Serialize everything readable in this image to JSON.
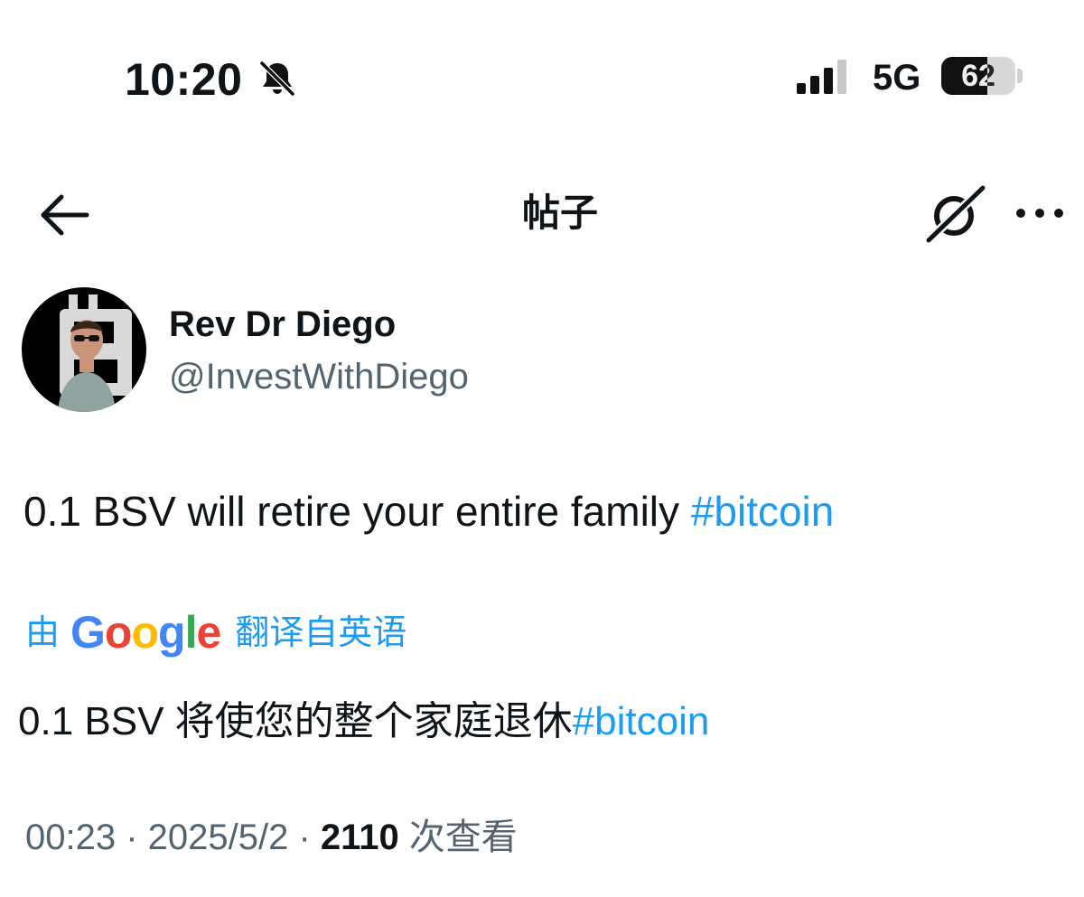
{
  "status_bar": {
    "time": "10:20",
    "silent_icon": "bell-slash-icon",
    "signal_icon": "cellular-signal-icon",
    "network": "5G",
    "battery_percent": "62",
    "battery_level": 0.62
  },
  "nav": {
    "back_icon": "arrow-left-icon",
    "title": "帖子",
    "grok_icon": "grok-icon",
    "more_icon": "more-horizontal-icon"
  },
  "author": {
    "name": "Rev Dr Diego",
    "handle": "@InvestWithDiego",
    "avatar_icon": "bitcoin-avatar"
  },
  "post": {
    "text": "0.1 BSV will retire your entire family ",
    "hashtag": "#bitcoin"
  },
  "translation": {
    "prefix": "由",
    "google_logo": {
      "G": "G",
      "o1": "o",
      "o2": "o",
      "g": "g",
      "l": "l",
      "e": "e"
    },
    "suffix": "翻译自英语",
    "text": "0.1 BSV 将使您的整个家庭退休",
    "hashtag": "#bitcoin"
  },
  "meta": {
    "time": "00:23",
    "separator": " · ",
    "date": "2025/5/2",
    "views_count": "2110",
    "views_label": " 次查看"
  },
  "colors": {
    "link": "#1d9bf0",
    "secondary_text": "#536471",
    "primary_text": "#0f1419"
  }
}
